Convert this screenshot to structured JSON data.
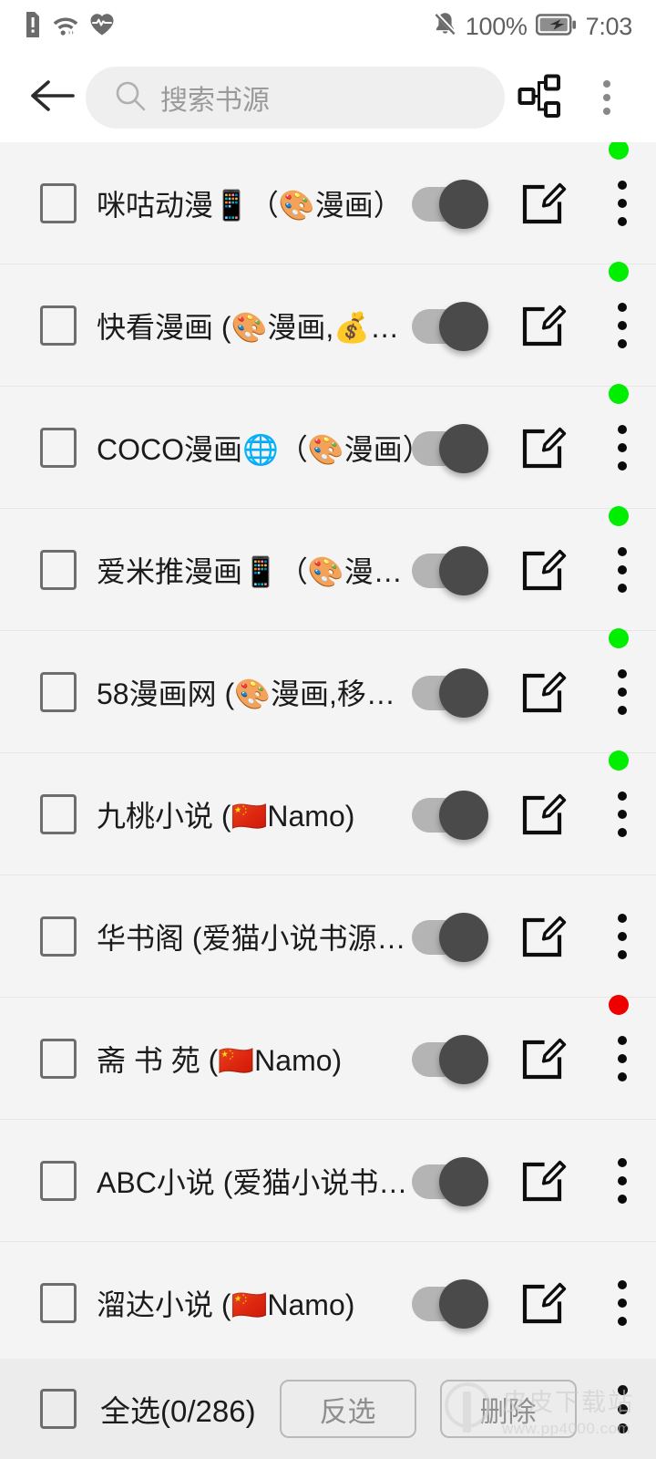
{
  "statusbar": {
    "icons_left": [
      "sim-alert-icon",
      "wifi-icon",
      "heartbeat-icon"
    ],
    "battery_percent": "100%",
    "time": "7:03",
    "icons_right": [
      "bell-muted-icon",
      "battery-charging-icon"
    ]
  },
  "toolbar": {
    "back_icon": "back-arrow-icon",
    "search_placeholder": "搜索书源",
    "search_value": "",
    "group_icon": "source-group-icon",
    "overflow_icon": "overflow-menu-icon"
  },
  "colors": {
    "status_ok": "#00ee00",
    "status_error": "#ee0000",
    "toggle_track": "#b4b4b4",
    "toggle_thumb": "#4a4a4a",
    "list_bg": "#f4f4f4",
    "bottom_bg": "#ececec"
  },
  "list": {
    "rows": [
      {
        "name": "咪咕动漫📱（🎨漫画）",
        "enabled": true,
        "status": "ok"
      },
      {
        "name": "快看漫画 (🎨漫画,💰…",
        "enabled": true,
        "status": "ok"
      },
      {
        "name": "COCO漫画🌐（🎨漫画）",
        "enabled": true,
        "status": "ok"
      },
      {
        "name": "爱米推漫画📱（🎨漫…",
        "enabled": true,
        "status": "ok"
      },
      {
        "name": "58漫画网 (🎨漫画,移…",
        "enabled": true,
        "status": "ok"
      },
      {
        "name": "九桃小说 (🇨🇳Namo)",
        "enabled": true,
        "status": "ok"
      },
      {
        "name": "华书阁 (爱猫小说书源…",
        "enabled": true,
        "status": "none"
      },
      {
        "name": "斋 书 苑 (🇨🇳Namo)",
        "enabled": true,
        "status": "error"
      },
      {
        "name": "ABC小说 (爱猫小说书…",
        "enabled": true,
        "status": "none"
      },
      {
        "name": "溜达小说 (🇨🇳Namo)",
        "enabled": true,
        "status": "none"
      }
    ]
  },
  "bottombar": {
    "select_all_label": "全选(0/286)",
    "invert_label": "反选",
    "delete_label": "删除",
    "overflow_icon": "overflow-menu-icon"
  },
  "watermark": {
    "title": "皮皮下载站",
    "url": "www.pp4000.com"
  }
}
